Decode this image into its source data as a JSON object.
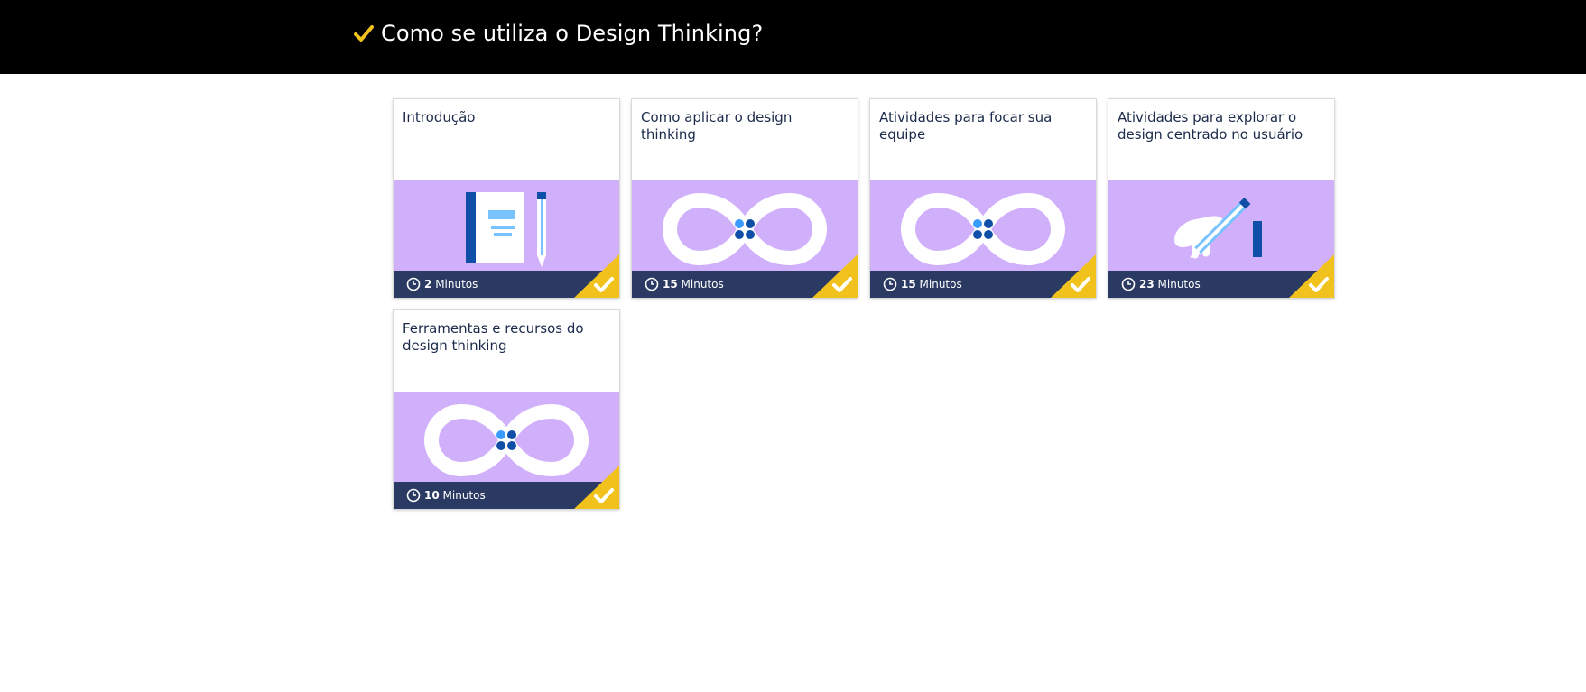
{
  "header": {
    "title": "Como se utiliza o Design Thinking?",
    "check_icon": "check-icon",
    "accent_color": "#f1c21b"
  },
  "cards": [
    {
      "title": "Introdução",
      "duration_value": "2",
      "duration_unit": "Minutos",
      "image": "notebook-pencil-illustration",
      "completed": true
    },
    {
      "title": "Como aplicar o design thinking",
      "duration_value": "15",
      "duration_unit": "Minutos",
      "image": "infinity-loop-illustration",
      "completed": true
    },
    {
      "title": "Atividades para focar sua equipe",
      "duration_value": "15",
      "duration_unit": "Minutos",
      "image": "infinity-loop-illustration",
      "completed": true
    },
    {
      "title": "Atividades para explorar o design centrado no usuário",
      "duration_value": "23",
      "duration_unit": "Minutos",
      "image": "hand-writing-illustration",
      "completed": true
    },
    {
      "title": "Ferramentas e recursos do design thinking",
      "duration_value": "10",
      "duration_unit": "Minutos",
      "image": "infinity-loop-illustration",
      "completed": true
    }
  ],
  "colors": {
    "card_image_bg": "#d1b0fb",
    "card_footer_bg": "#2b3a63",
    "completed_corner": "#f1c21b",
    "title_text": "#1b2a4a"
  }
}
